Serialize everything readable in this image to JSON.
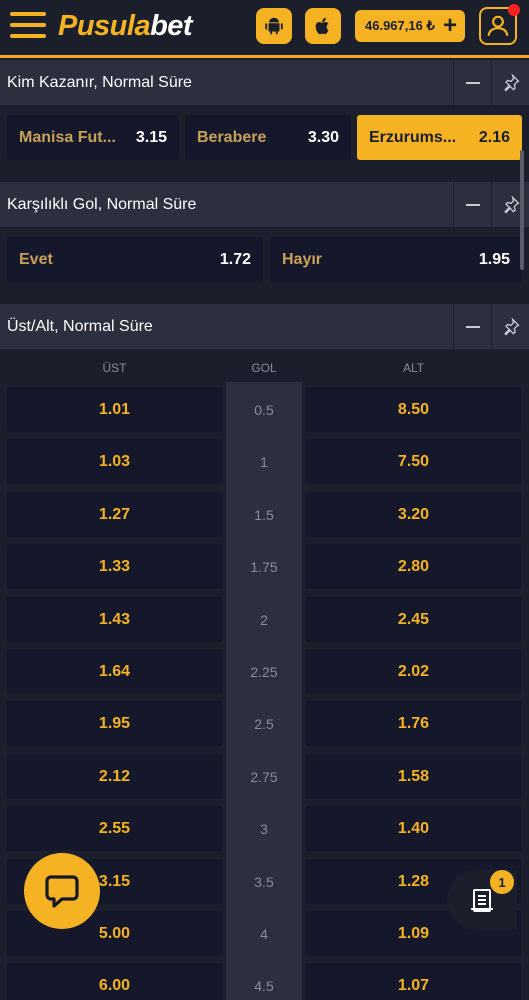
{
  "header": {
    "logo_part1": "Pusula",
    "logo_part2": "bet",
    "balance": "46.967,16 ₺",
    "balance_plus": "+"
  },
  "markets": {
    "match_result": {
      "title": "Kim Kazanır, Normal Süre",
      "options": [
        {
          "label": "Manisa Fut...",
          "odd": "3.15",
          "selected": false
        },
        {
          "label": "Berabere",
          "odd": "3.30",
          "selected": false
        },
        {
          "label": "Erzurums...",
          "odd": "2.16",
          "selected": true
        }
      ]
    },
    "both_score": {
      "title": "Karşılıklı Gol, Normal Süre",
      "options": [
        {
          "label": "Evet",
          "odd": "1.72"
        },
        {
          "label": "Hayır",
          "odd": "1.95"
        }
      ]
    },
    "over_under": {
      "title": "Üst/Alt, Normal Süre",
      "col_over": "ÜST",
      "col_goal": "GOL",
      "col_under": "ALT",
      "rows": [
        {
          "over": "1.01",
          "goal": "0.5",
          "under": "8.50"
        },
        {
          "over": "1.03",
          "goal": "1",
          "under": "7.50"
        },
        {
          "over": "1.27",
          "goal": "1.5",
          "under": "3.20"
        },
        {
          "over": "1.33",
          "goal": "1.75",
          "under": "2.80"
        },
        {
          "over": "1.43",
          "goal": "2",
          "under": "2.45"
        },
        {
          "over": "1.64",
          "goal": "2.25",
          "under": "2.02"
        },
        {
          "over": "1.95",
          "goal": "2.5",
          "under": "1.76"
        },
        {
          "over": "2.12",
          "goal": "2.75",
          "under": "1.58"
        },
        {
          "over": "2.55",
          "goal": "3",
          "under": "1.40"
        },
        {
          "over": "3.15",
          "goal": "3.5",
          "under": "1.28"
        },
        {
          "over": "5.00",
          "goal": "4",
          "under": "1.09"
        },
        {
          "over": "6.00",
          "goal": "4.5",
          "under": "1.07"
        }
      ]
    }
  },
  "betslip": {
    "count": "1"
  },
  "colors": {
    "accent": "#f5b324",
    "background": "#1b1e2b",
    "panel": "#2b2f3e",
    "cell": "#15182a"
  },
  "icons": [
    "hamburger-icon",
    "android-icon",
    "apple-icon",
    "plus-icon",
    "user-icon",
    "minus-icon",
    "pin-icon",
    "chat-icon",
    "betslip-icon"
  ]
}
